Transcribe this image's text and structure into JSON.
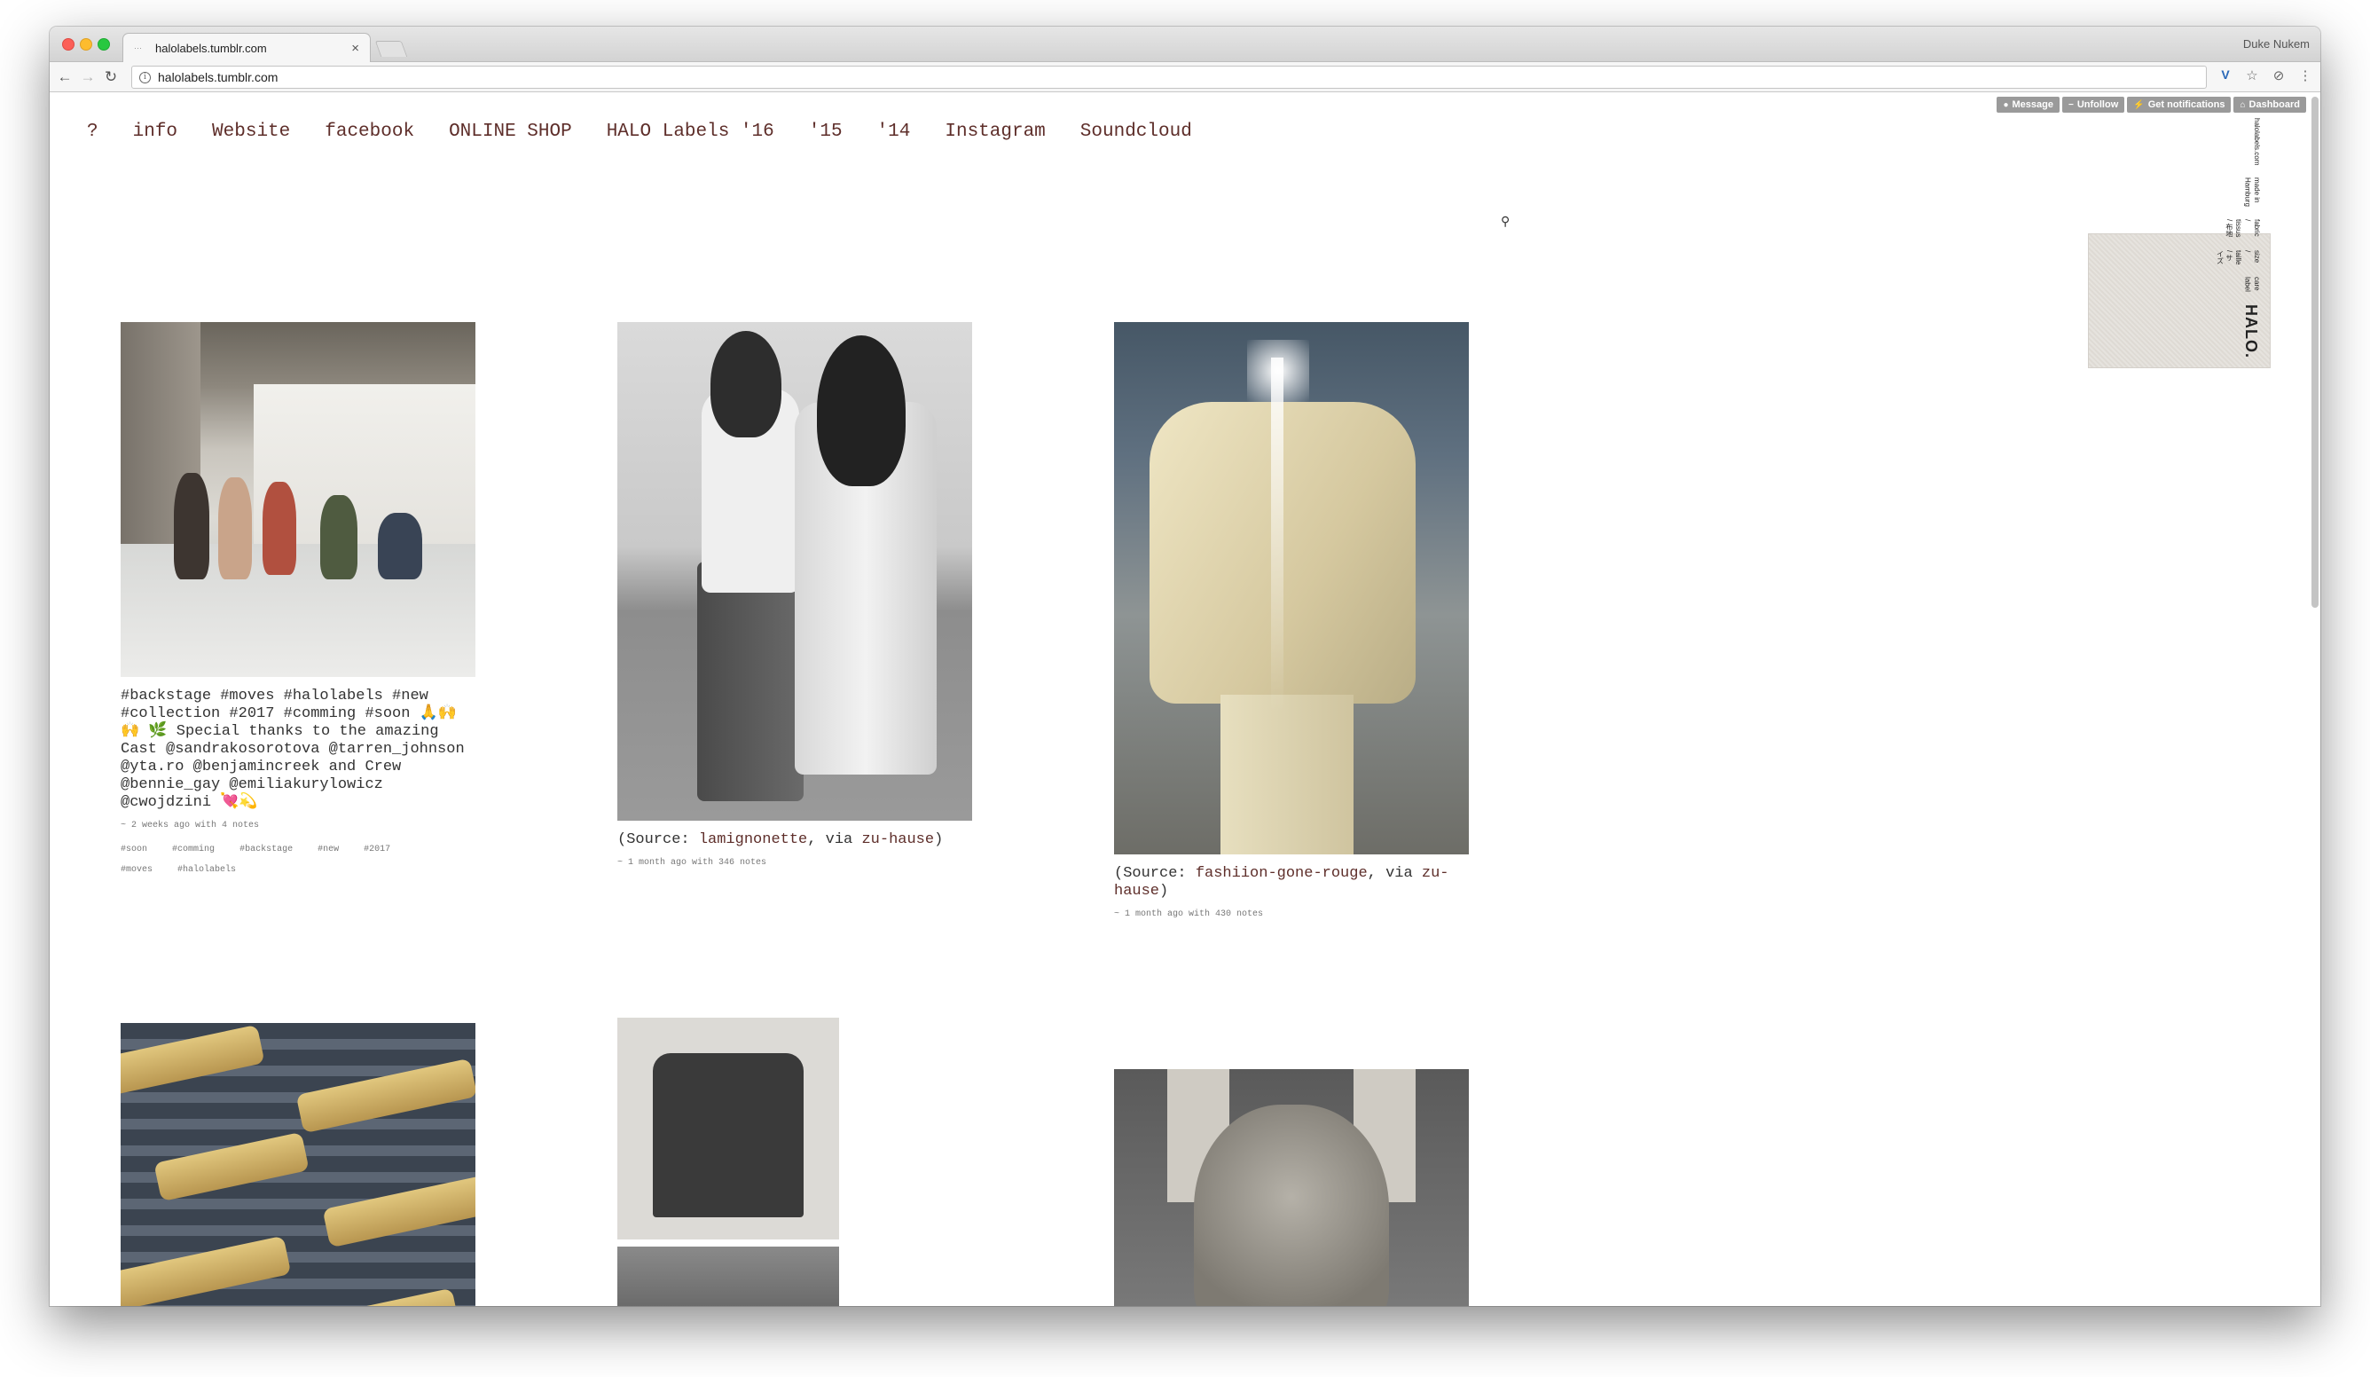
{
  "browser": {
    "tab_title": "halolabels.tumblr.com",
    "tab_close": "×",
    "profile_name": "Duke Nukem",
    "url": "halolabels.tumblr.com"
  },
  "tumblr_controls": {
    "message": "Message",
    "unfollow": "Unfollow",
    "notifications": "Get notifications",
    "dashboard": "Dashboard"
  },
  "nav": {
    "items": [
      "?",
      "info",
      "Website",
      "facebook",
      "ONLINE SHOP",
      "HALO Labels '16",
      "'15",
      "'14",
      "Instagram",
      "Soundcloud"
    ]
  },
  "sidebar_label": {
    "brand": "HALO.",
    "lines": [
      "care label",
      "halolabels.com",
      "size / taille / サイズ",
      "fabric / tissus / 布地",
      "made in Hamburg"
    ]
  },
  "posts": [
    {
      "caption": "#backstage #moves #halolabels #new #collection #2017 #comming #soon 🙏🙌🙌 🌿 Special thanks to the amazing Cast @sandrakosorotova @tarren_johnson @yta.ro @benjamincreek and Crew @bennie_gay @emiliakurylowicz @cwojdzini 💘💫",
      "meta": "~ 2 weeks ago with 4 notes",
      "tags": [
        "#soon",
        "#comming",
        "#backstage",
        "#new",
        "#2017",
        "#moves",
        "#halolabels"
      ]
    },
    {
      "caption_prefix": "(Source: ",
      "source": "lamignonette",
      "caption_mid": ", via ",
      "via": "zu-hause",
      "caption_suffix": ")",
      "meta": "~ 1 month ago with 346 notes"
    },
    {
      "caption_prefix": "(Source: ",
      "source": "fashiion-gone-rouge",
      "caption_mid": ", via ",
      "via": "zu-hause",
      "caption_suffix": ")",
      "meta": "~ 1 month ago with 430 notes"
    }
  ]
}
